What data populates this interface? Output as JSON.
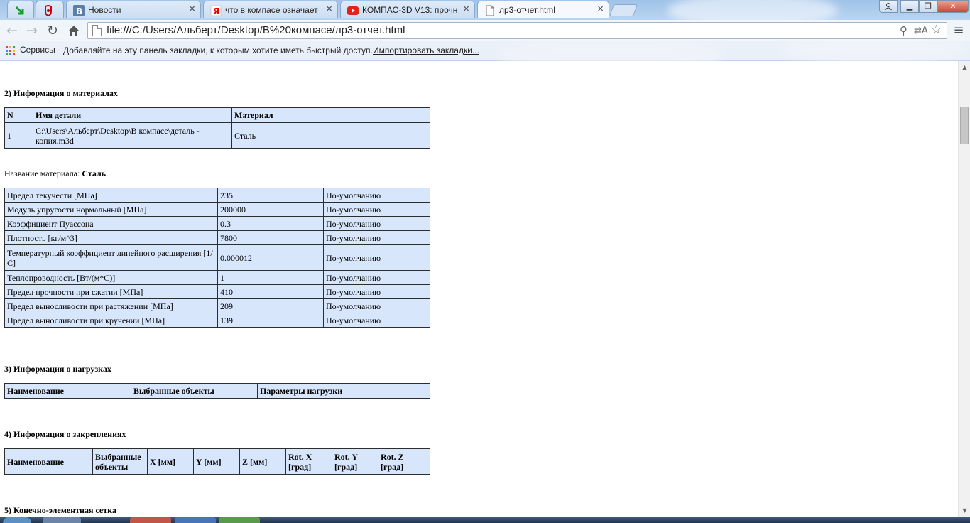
{
  "browser": {
    "tabs": [
      {
        "title": "",
        "icon": "download-arrow-icon"
      },
      {
        "title": "",
        "icon": "antivirus-icon"
      },
      {
        "title": "Новости",
        "icon": "vk-icon"
      },
      {
        "title": "что в компасе означает",
        "icon": "yandex-icon"
      },
      {
        "title": "КОМПАС-3D V13: прочн",
        "icon": "youtube-icon"
      },
      {
        "title": "лр3-отчет.html",
        "icon": "page-icon",
        "active": true
      }
    ],
    "url": "file:///C:/Users/Альберт/Desktop/В%20компасе/лр3-отчет.html",
    "bookmarks": {
      "apps_label": "Сервисы",
      "hint": "Добавляйте на эту панель закладки, к которым хотите иметь быстрый доступ.",
      "import_link": "Импортировать закладки..."
    }
  },
  "report": {
    "materials": {
      "title": "2) Информация о материалах",
      "headers": [
        "N",
        "Имя детали",
        "Материал"
      ],
      "rows": [
        [
          "1",
          "C:\\Users\\Альберт\\Desktop\\В компасе\\деталь - копия.m3d",
          "Сталь"
        ]
      ],
      "name_label": "Название материала:",
      "name_value": "Сталь",
      "props": [
        [
          "Предел текучести [МПа]",
          "235",
          "По-умолчанию"
        ],
        [
          "Модуль упругости нормальный [МПа]",
          "200000",
          "По-умолчанию"
        ],
        [
          "Коэффициент Пуассона",
          "0.3",
          "По-умолчанию"
        ],
        [
          "Плотность [кг/м^3]",
          "7800",
          "По-умолчанию"
        ],
        [
          "Температурный коэффициент линейного расширения [1/С]",
          "0.000012",
          "По-умолчанию"
        ],
        [
          "Теплопроводность [Вт/(м*С)]",
          "1",
          "По-умолчанию"
        ],
        [
          "Предел прочности при сжатии [МПа]",
          "410",
          "По-умолчанию"
        ],
        [
          "Предел выносливости при растяжении [МПа]",
          "209",
          "По-умолчанию"
        ],
        [
          "Предел выносливости при кручении [МПа]",
          "139",
          "По-умолчанию"
        ]
      ]
    },
    "loads": {
      "title": "3) Информация о нагрузках",
      "headers": [
        "Наименование",
        "Выбранные объекты",
        "Параметры нагрузки"
      ]
    },
    "fixings": {
      "title": "4) Информация о закреплениях",
      "headers": [
        "Наименование",
        "Выбранные объекты",
        "X [мм]",
        "Y [мм]",
        "Z [мм]",
        "Rot. X [град]",
        "Rot. Y [град]",
        "Rot. Z [град]"
      ]
    },
    "mesh": {
      "title": "5) Конечно-элементная сетка"
    }
  }
}
